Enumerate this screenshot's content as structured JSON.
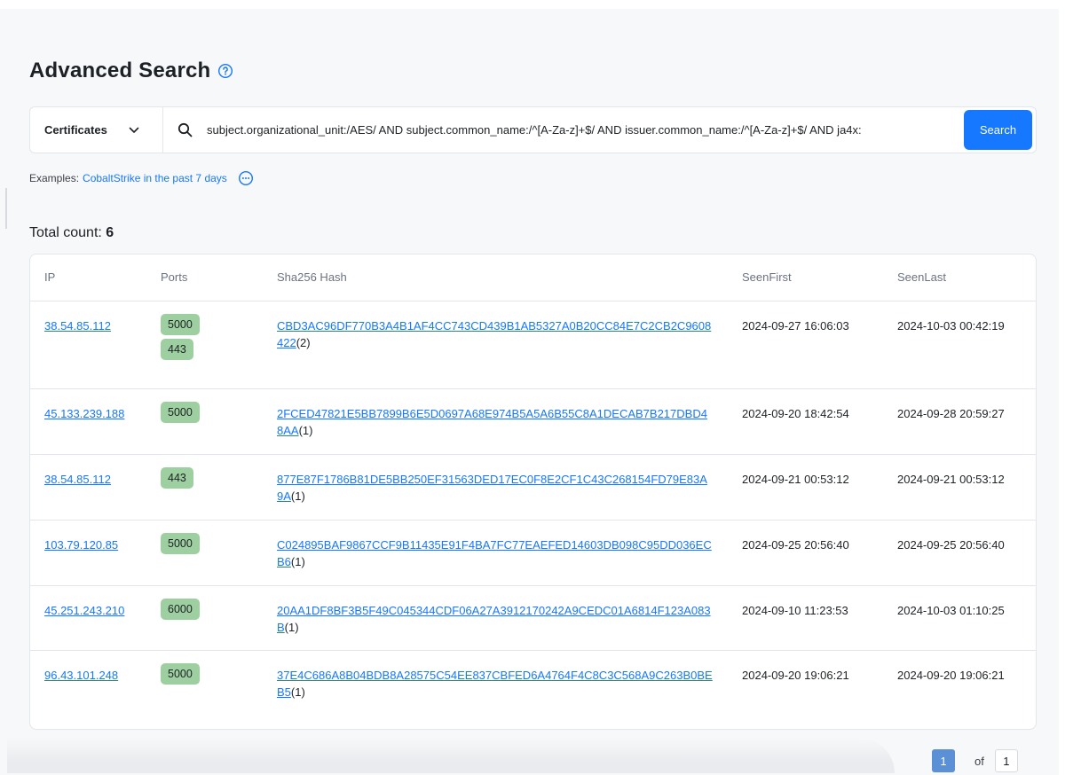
{
  "header": {
    "title": "Advanced Search"
  },
  "search": {
    "type_label": "Certificates",
    "query": "subject.organizational_unit:/AES/ AND subject.common_name:/^[A-Za-z]+$/ AND issuer.common_name:/^[A-Za-z]+$/ AND ja4x:",
    "button_label": "Search"
  },
  "examples": {
    "label": "Examples:",
    "link_text": "CobaltStrike in the past 7 days"
  },
  "results": {
    "total_label": "Total count:",
    "total_value": "6",
    "columns": [
      "IP",
      "Ports",
      "Sha256 Hash",
      "SeenFirst",
      "SeenLast"
    ],
    "rows": [
      {
        "ip": "38.54.85.112",
        "ports": [
          "5000",
          "443"
        ],
        "hash": "CBD3AC96DF770B3A4B1AF4CC743CD439B1AB5327A0B20CC84E7C2CB2C9608422",
        "count": "(2)",
        "seen_first": "2024-09-27 16:06:03",
        "seen_last": "2024-10-03 00:42:19"
      },
      {
        "ip": "45.133.239.188",
        "ports": [
          "5000"
        ],
        "hash": "2FCED47821E5BB7899B6E5D0697A68E974B5A5A6B55C8A1DECAB7B217DBD48AA",
        "count": "(1)",
        "seen_first": "2024-09-20 18:42:54",
        "seen_last": "2024-09-28 20:59:27"
      },
      {
        "ip": "38.54.85.112",
        "ports": [
          "443"
        ],
        "hash": "877E87F1786B81DE5BB250EF31563DED17EC0F8E2CF1C43C268154FD79E83A9A",
        "count": "(1)",
        "seen_first": "2024-09-21 00:53:12",
        "seen_last": "2024-09-21 00:53:12"
      },
      {
        "ip": "103.79.120.85",
        "ports": [
          "5000"
        ],
        "hash": "C024895BAF9867CCF9B11435E91F4BA7FC77EAEFED14603DB098C95DD036ECB6",
        "count": "(1)",
        "seen_first": "2024-09-25 20:56:40",
        "seen_last": "2024-09-25 20:56:40"
      },
      {
        "ip": "45.251.243.210",
        "ports": [
          "6000"
        ],
        "hash": "20AA1DF8BF3B5F49C045344CDF06A27A3912170242A9CEDC01A6814F123A083B",
        "count": "(1)",
        "seen_first": "2024-09-10 11:23:53",
        "seen_last": "2024-10-03 01:10:25"
      },
      {
        "ip": "96.43.101.248",
        "ports": [
          "5000"
        ],
        "hash": "37E4C686A8B04BDB8A28575C54EE837CBFED6A4764F4C8C3C568A9C263B0BEB5",
        "count": "(1)",
        "seen_first": "2024-09-20 19:06:21",
        "seen_last": "2024-09-20 19:06:21"
      }
    ]
  },
  "pagination": {
    "current": "1",
    "of_label": "of",
    "total": "1"
  },
  "colors": {
    "accent": "#1677ff",
    "port_badge": "#9ecfa1",
    "page_active": "#5b8fd6"
  },
  "icons": {
    "help": "question-circle-icon",
    "chevron": "chevron-down-icon",
    "search": "search-icon",
    "more": "ellipsis-circle-icon"
  }
}
